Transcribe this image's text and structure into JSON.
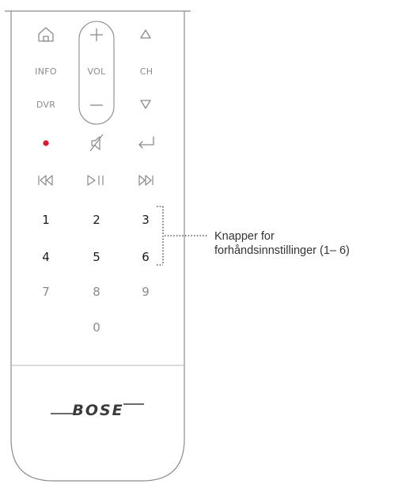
{
  "remote": {
    "top_row_labels": {
      "info": "INFO",
      "vol": "VOL",
      "ch": "CH",
      "dvr": "DVR"
    },
    "icons": [
      "home-icon",
      "volume-up-icon",
      "channel-up-icon",
      "volume-down-icon",
      "channel-down-icon",
      "record-icon",
      "mute-icon",
      "back-icon",
      "rewind-icon",
      "play-pause-icon",
      "fast-forward-icon"
    ],
    "record_color": "#e0182d",
    "preset_keys": [
      "1",
      "2",
      "3",
      "4",
      "5",
      "6"
    ],
    "other_keys": [
      "7",
      "8",
      "9",
      "0"
    ],
    "brand": "BOSE"
  },
  "callout": {
    "line1": "Knapper for",
    "line2": "forhåndsinnstillinger (1– 6)"
  }
}
